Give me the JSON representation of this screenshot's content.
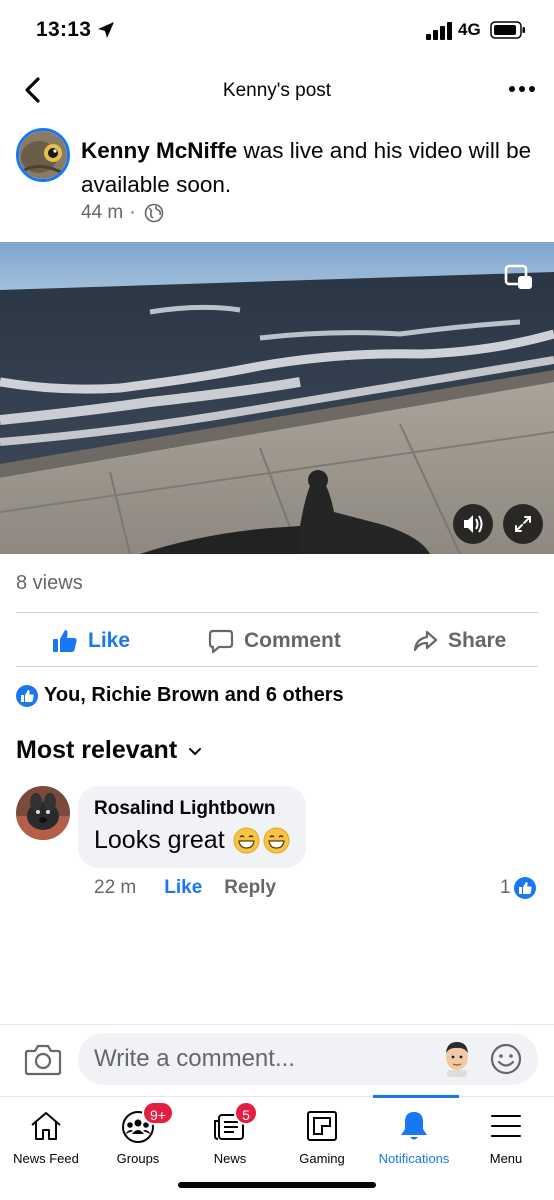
{
  "status_bar": {
    "time": "13:13",
    "network": "4G"
  },
  "header": {
    "title": "Kenny's post"
  },
  "post": {
    "author": "Kenny McNiffe",
    "text": " was live and his video will be available soon.",
    "time": "44 m",
    "separator": "·",
    "views": "8 views"
  },
  "actions": {
    "like": "Like",
    "comment": "Comment",
    "share": "Share"
  },
  "reactions": {
    "summary": "You, Richie Brown and 6 others"
  },
  "comments_section": {
    "sort_label": "Most relevant",
    "comments": [
      {
        "author": "Rosalind Lightbown",
        "text": "Looks great",
        "emojis": [
          "grinning-face",
          "grinning-face"
        ],
        "time": "22 m",
        "like_label": "Like",
        "reply_label": "Reply",
        "like_count": "1"
      }
    ]
  },
  "composer": {
    "placeholder": "Write a comment..."
  },
  "tabs": [
    {
      "label": "News Feed",
      "icon": "home-icon"
    },
    {
      "label": "Groups",
      "icon": "groups-icon",
      "badge": "9+"
    },
    {
      "label": "News",
      "icon": "news-icon",
      "badge": "5"
    },
    {
      "label": "Gaming",
      "icon": "gaming-icon"
    },
    {
      "label": "Notifications",
      "icon": "bell-icon",
      "active": true
    },
    {
      "label": "Menu",
      "icon": "menu-icon"
    }
  ],
  "colors": {
    "accent": "#1877f2",
    "badge": "#e41e3f",
    "secondary_text": "#65676b",
    "bubble": "#f0f2f5"
  }
}
